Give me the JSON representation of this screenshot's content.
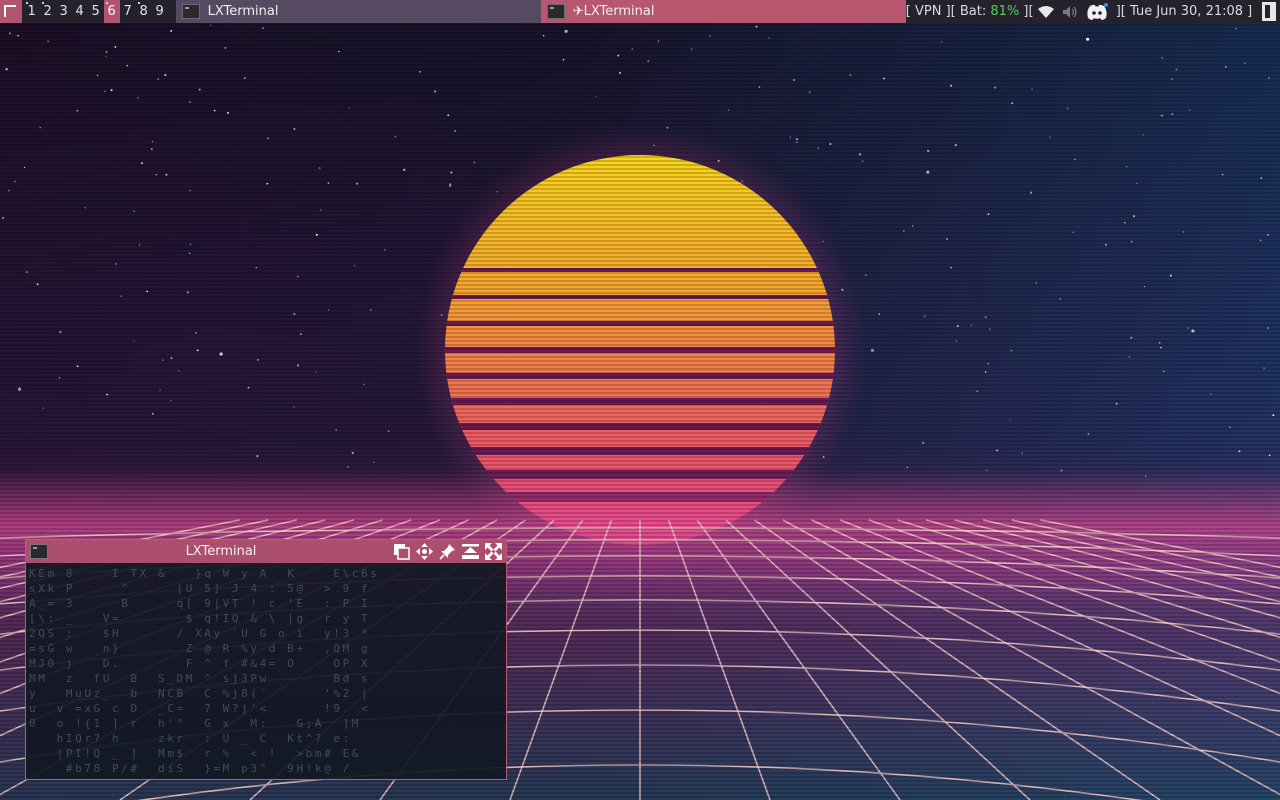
{
  "topbar": {
    "workspaces": [
      "1",
      "2",
      "3",
      "4",
      "5",
      "6",
      "7",
      "8",
      "9"
    ],
    "active_workspace": "6",
    "tasks": [
      {
        "label": "LXTerminal"
      },
      {
        "label": "✈LXTerminal"
      }
    ],
    "status": {
      "vpn": "[ VPN ][ Bat: ",
      "battery": "81%",
      "sep": " ][",
      "sep2": " ][ ",
      "clock": "Tue Jun 30, 21:08",
      "end": " ]"
    }
  },
  "terminal": {
    "title": "LXTerminal",
    "lines": [
      "KEm 8    I TX &   }q W y A  K    E\\c6s",
      "sXk P     ^     |U 5] J 4 : 5@  > 9 f",
      "A_= 3     B     q[ 9|VT ! c 'E  : P I",
      "[\\: _   V=       $ q!IQ & \\ |g  r y T",
      "2QS :   $H      / XAy `U G o i  y!3 *",
      "=sG w   n}       Z @ R %y d B+  ,QM g",
      "MJ0 j   D.       F ^ f #&4= O    OP X",
      "MM  z  fU  B  S_DM ^ sj3Pw       Bd s",
      "y   MuUz_  b  NCB  C %j8(`      '%2 |",
      "u  v =xG c D  _C=  7 W?j'<      !9  <",
      "0  o !{1 ] r  h'\"  G x  M:   G;A  ]M",
      "   hIQr? h    zkr  : U _ C  Kt^? e:",
      "   |PI!Q _ ]  Mm$  r %  < !  >bm# E&",
      "    #b78 P/#  diS  }=M p3\"  9H!k@ /"
    ]
  },
  "colors": {
    "accent": "#b1546f",
    "bar_bg": "#25222c",
    "battery": "#52d15a",
    "sun_top": "#f6d41a",
    "sun_bottom": "#e8407e"
  },
  "icons": [
    "launcher-icon",
    "terminal-icon",
    "wifi-icon",
    "volume-icon",
    "discord-icon",
    "window-restore-icon",
    "move-icon",
    "pin-icon",
    "shade-icon",
    "fullscreen-icon"
  ]
}
